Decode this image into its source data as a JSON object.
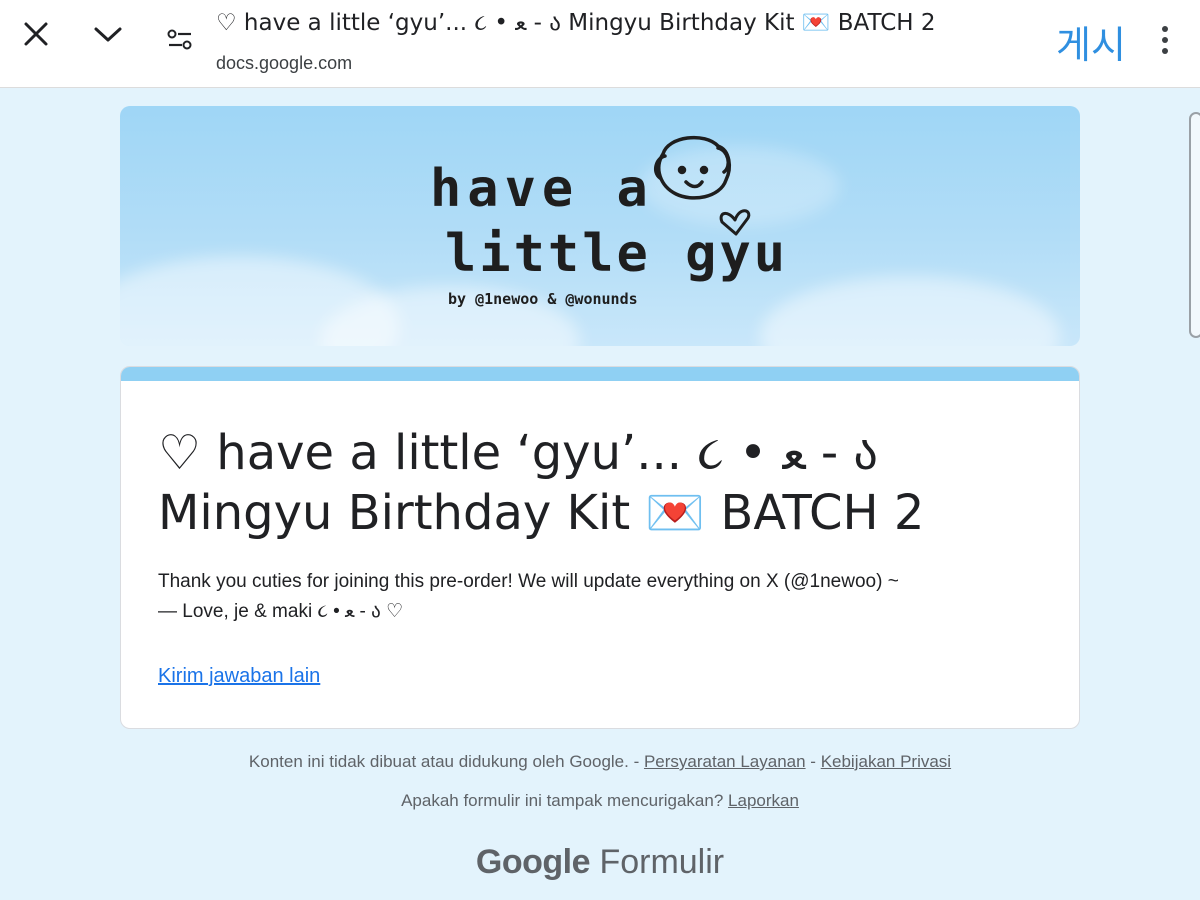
{
  "browser": {
    "title": "♡ have a little ‘gyu’... ૮ • ﻌ - ა Mingyu Birthday Kit 💌 BATCH 2",
    "url": "docs.google.com",
    "action_label": "게시",
    "icons": [
      "close-icon",
      "chevron-down-icon",
      "tune-icon",
      "more-vert-icon"
    ]
  },
  "banner": {
    "line1": "have a",
    "line2": "little gyu",
    "credit": "by @1newoo & @wonunds"
  },
  "form": {
    "title": "♡ have a little ‘gyu’... ૮ • ﻌ - ა Mingyu Birthday Kit 💌 BATCH 2",
    "description_line1": "Thank you cuties for joining this pre-order! We will update everything on X (@1newoo) ~",
    "description_line2": "— Love, je & maki ૮ • ﻌ - ა ♡",
    "submit_another": "Kirim jawaban lain",
    "accent_color": "#8fd0f3"
  },
  "footer": {
    "disclaimer": "Konten ini tidak dibuat atau didukung oleh Google.",
    "sep1": " - ",
    "terms": "Persyaratan Layanan",
    "sep2": " - ",
    "privacy": "Kebijakan Privasi",
    "suspicious": "Apakah formulir ini tampak mencurigakan?",
    "report": "Laporkan",
    "logo_google": "Google",
    "logo_product": "Formulir"
  },
  "colors": {
    "page_bg": "#e3f3fc",
    "link": "#1a73e8",
    "action": "#2f8fe0"
  }
}
